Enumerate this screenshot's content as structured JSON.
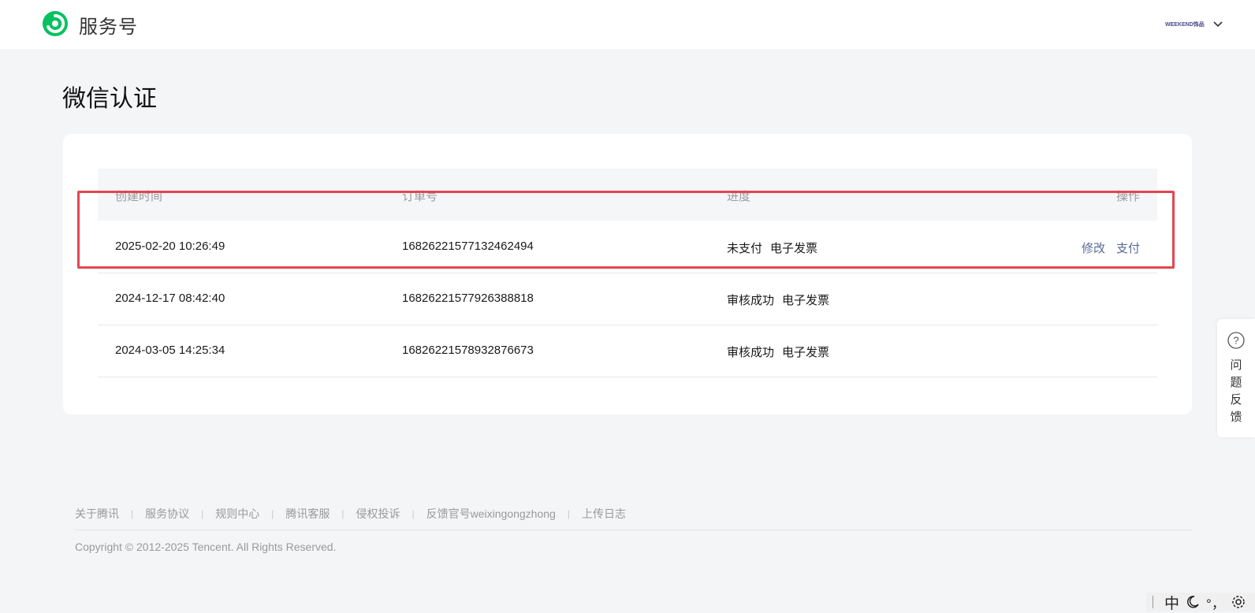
{
  "header": {
    "brand": "服务号",
    "account_name": "WEEKEND饰品"
  },
  "page": {
    "title": "微信认证"
  },
  "table": {
    "columns": [
      "创建时间",
      "订单号",
      "进度",
      "操作"
    ],
    "rows": [
      {
        "created": "2025-02-20 10:26:49",
        "order_no": "16826221577132462494",
        "status": "未支付",
        "invoice": "电子发票",
        "actions": [
          "修改",
          "支付"
        ]
      },
      {
        "created": "2024-12-17 08:42:40",
        "order_no": "16826221577926388818",
        "status": "审核成功",
        "invoice": "电子发票"
      },
      {
        "created": "2024-03-05 14:25:34",
        "order_no": "16826221578932876673",
        "status": "审核成功",
        "invoice": "电子发票"
      }
    ]
  },
  "feedback": {
    "label": "问题反馈"
  },
  "footer": {
    "links": [
      "关于腾讯",
      "服务协议",
      "规则中心",
      "腾讯客服",
      "侵权投诉",
      "反馈官号weixingongzhong",
      "上传日志"
    ],
    "copyright": "Copyright © 2012-2025 Tencent. All Rights Reserved."
  },
  "ime": {
    "mode": "中",
    "punct": "°，"
  },
  "colors": {
    "brand_green": "#07c160",
    "link": "#576b95",
    "highlight": "#e4454f"
  },
  "icons": [
    "wechat-service-logo",
    "chevron-down-icon",
    "question-icon",
    "moon-icon",
    "gear-icon"
  ]
}
